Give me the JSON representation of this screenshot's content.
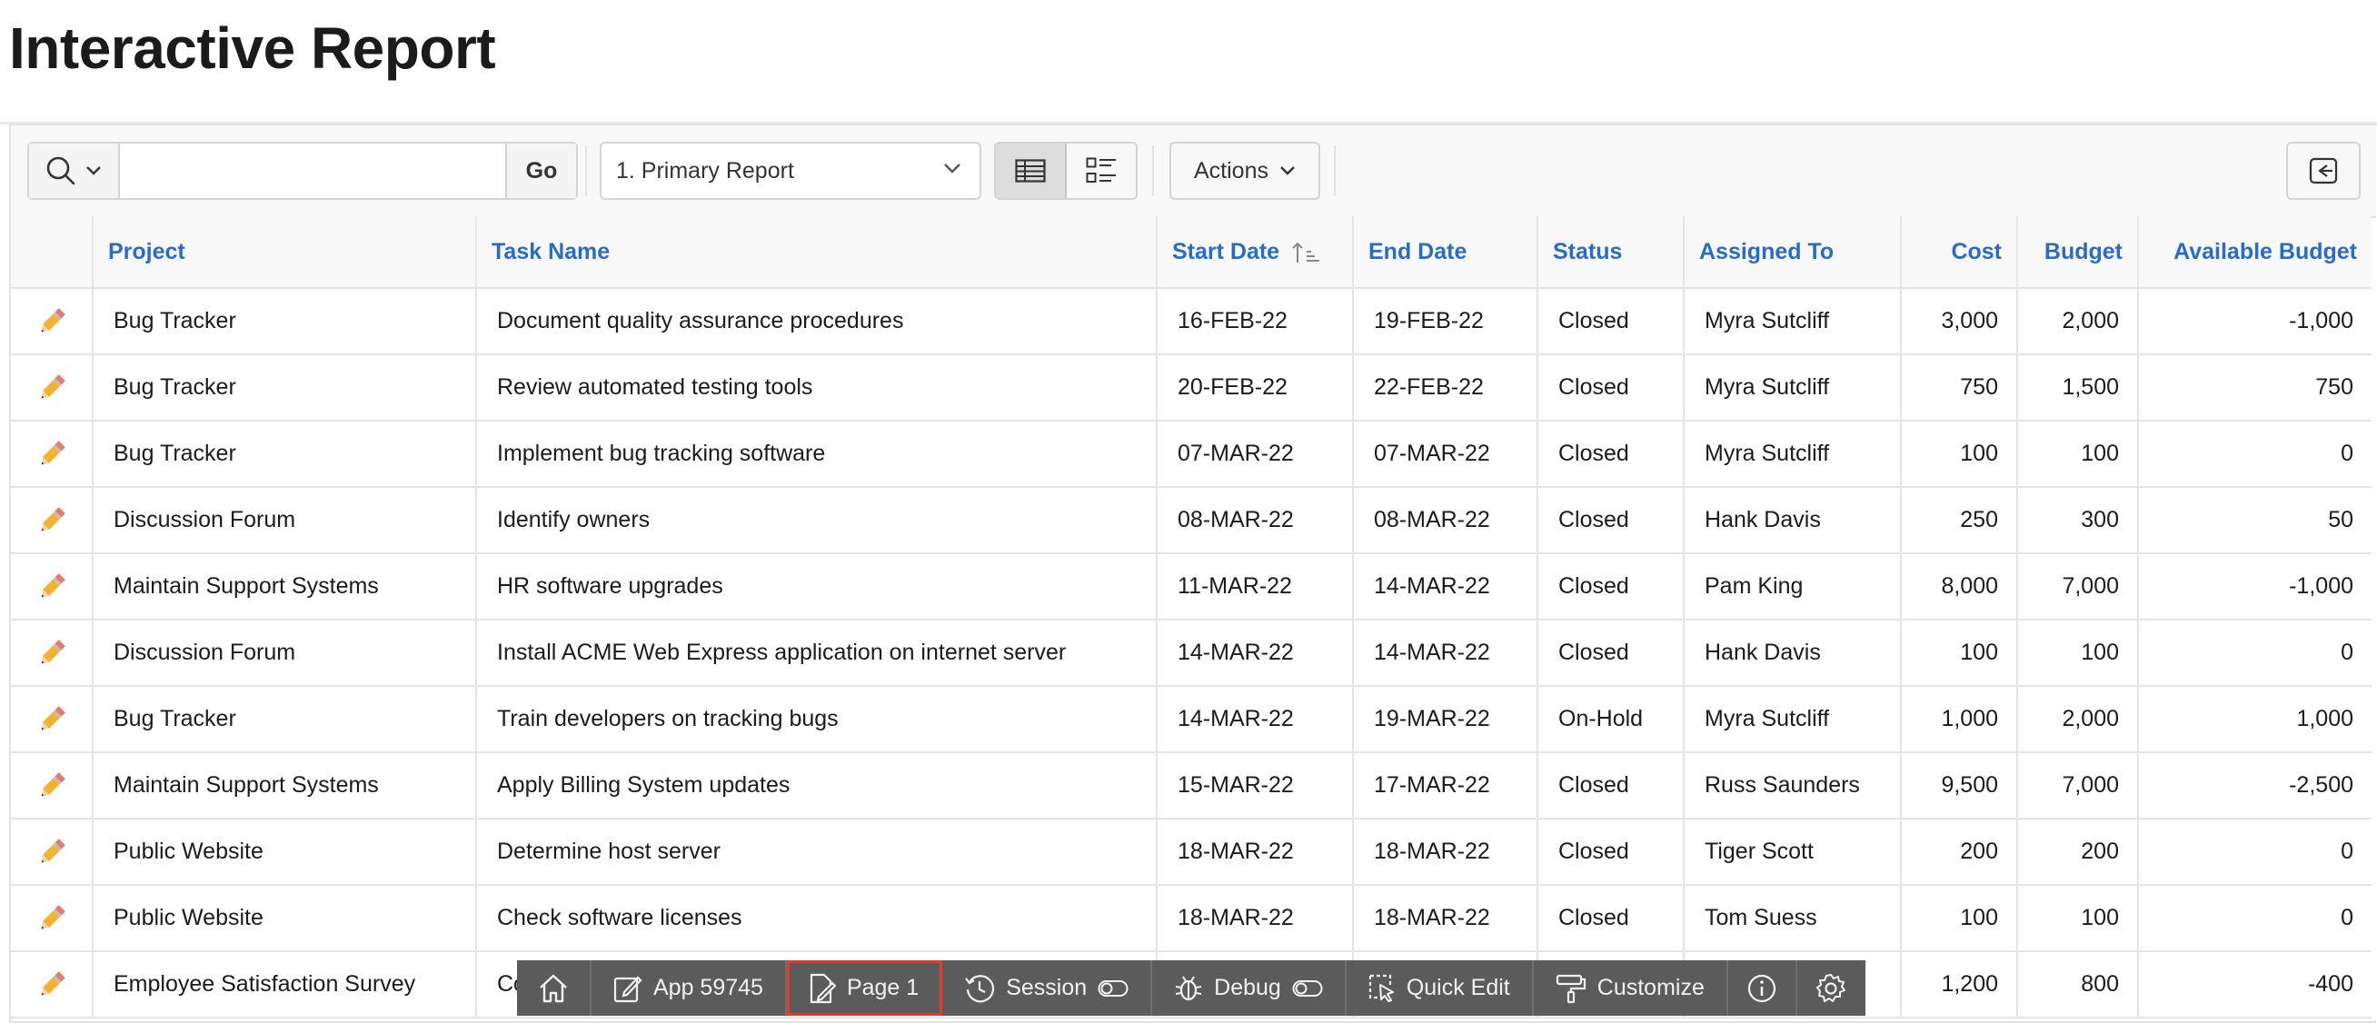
{
  "page": {
    "title": "Interactive Report"
  },
  "toolbar": {
    "search_placeholder": "",
    "go_label": "Go",
    "report_select_value": "1. Primary Report",
    "actions_label": "Actions"
  },
  "columns": {
    "project": "Project",
    "task_name": "Task Name",
    "start_date": "Start Date",
    "end_date": "End Date",
    "status": "Status",
    "assigned_to": "Assigned To",
    "cost": "Cost",
    "budget": "Budget",
    "available_budget": "Available Budget"
  },
  "rows": [
    {
      "project": "Bug Tracker",
      "task": "Document quality assurance procedures",
      "start": "16-FEB-22",
      "end": "19-FEB-22",
      "status": "Closed",
      "assigned": "Myra Sutcliff",
      "cost": "3,000",
      "budget": "2,000",
      "available": "-1,000"
    },
    {
      "project": "Bug Tracker",
      "task": "Review automated testing tools",
      "start": "20-FEB-22",
      "end": "22-FEB-22",
      "status": "Closed",
      "assigned": "Myra Sutcliff",
      "cost": "750",
      "budget": "1,500",
      "available": "750"
    },
    {
      "project": "Bug Tracker",
      "task": "Implement bug tracking software",
      "start": "07-MAR-22",
      "end": "07-MAR-22",
      "status": "Closed",
      "assigned": "Myra Sutcliff",
      "cost": "100",
      "budget": "100",
      "available": "0"
    },
    {
      "project": "Discussion Forum",
      "task": "Identify owners",
      "start": "08-MAR-22",
      "end": "08-MAR-22",
      "status": "Closed",
      "assigned": "Hank Davis",
      "cost": "250",
      "budget": "300",
      "available": "50"
    },
    {
      "project": "Maintain Support Systems",
      "task": "HR software upgrades",
      "start": "11-MAR-22",
      "end": "14-MAR-22",
      "status": "Closed",
      "assigned": "Pam King",
      "cost": "8,000",
      "budget": "7,000",
      "available": "-1,000"
    },
    {
      "project": "Discussion Forum",
      "task": "Install ACME Web Express application on internet server",
      "start": "14-MAR-22",
      "end": "14-MAR-22",
      "status": "Closed",
      "assigned": "Hank Davis",
      "cost": "100",
      "budget": "100",
      "available": "0"
    },
    {
      "project": "Bug Tracker",
      "task": "Train developers on tracking bugs",
      "start": "14-MAR-22",
      "end": "19-MAR-22",
      "status": "On-Hold",
      "assigned": "Myra Sutcliff",
      "cost": "1,000",
      "budget": "2,000",
      "available": "1,000"
    },
    {
      "project": "Maintain Support Systems",
      "task": "Apply Billing System updates",
      "start": "15-MAR-22",
      "end": "17-MAR-22",
      "status": "Closed",
      "assigned": "Russ Saunders",
      "cost": "9,500",
      "budget": "7,000",
      "available": "-2,500"
    },
    {
      "project": "Public Website",
      "task": "Determine host server",
      "start": "18-MAR-22",
      "end": "18-MAR-22",
      "status": "Closed",
      "assigned": "Tiger Scott",
      "cost": "200",
      "budget": "200",
      "available": "0"
    },
    {
      "project": "Public Website",
      "task": "Check software licenses",
      "start": "18-MAR-22",
      "end": "18-MAR-22",
      "status": "Closed",
      "assigned": "Tom Suess",
      "cost": "100",
      "budget": "100",
      "available": "0"
    },
    {
      "project": "Employee Satisfaction Survey",
      "task": "Co",
      "start": "",
      "end": "",
      "status": "",
      "assigned": "",
      "cost": "1,200",
      "budget": "800",
      "available": "-400"
    }
  ],
  "dev_toolbar": {
    "home_icon": "home-icon",
    "app_label": "App 59745",
    "page_label": "Page 1",
    "session_label": "Session",
    "debug_label": "Debug",
    "quick_edit_label": "Quick Edit",
    "customize_label": "Customize"
  },
  "colors": {
    "header_link": "#2a6cc0",
    "dev_toolbar_bg": "#5b5b5b",
    "highlight": "#e53b2f",
    "edit_pencil": "#e8a33a"
  }
}
